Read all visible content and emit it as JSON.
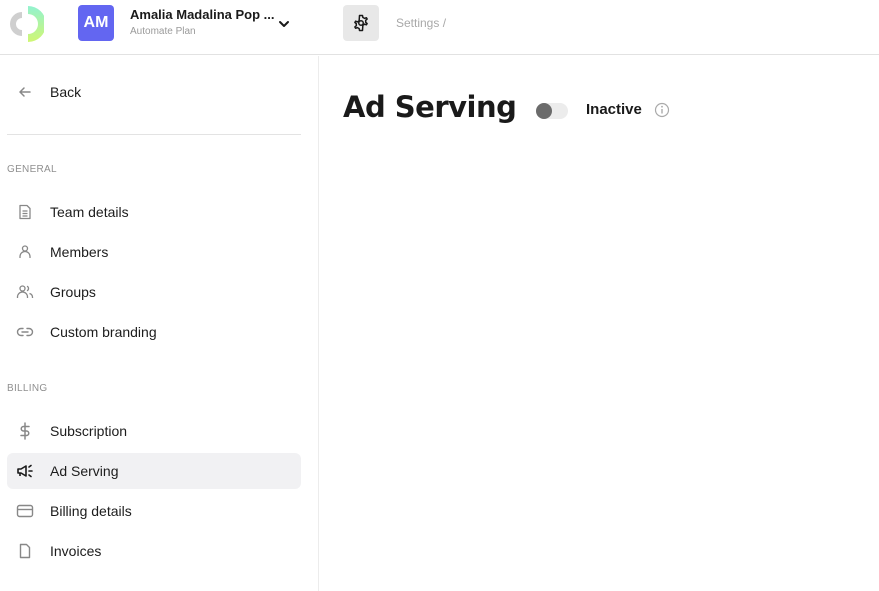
{
  "header": {
    "avatar_initials": "AM",
    "team_name": "Amalia Madalina Pop ...",
    "plan": "Automate Plan",
    "breadcrumb": "Settings /"
  },
  "sidebar": {
    "back_label": "Back",
    "sections": [
      {
        "title": "GENERAL",
        "items": [
          {
            "label": "Team details",
            "icon": "document-icon"
          },
          {
            "label": "Members",
            "icon": "user-icon"
          },
          {
            "label": "Groups",
            "icon": "users-icon"
          },
          {
            "label": "Custom branding",
            "icon": "link-icon"
          }
        ]
      },
      {
        "title": "BILLING",
        "items": [
          {
            "label": "Subscription",
            "icon": "dollar-icon"
          },
          {
            "label": "Ad Serving",
            "icon": "megaphone-icon",
            "active": true
          },
          {
            "label": "Billing details",
            "icon": "credit-card-icon"
          },
          {
            "label": "Invoices",
            "icon": "file-icon"
          }
        ]
      }
    ]
  },
  "main": {
    "title": "Ad Serving",
    "toggle_on": false,
    "status": "Inactive"
  },
  "colors": {
    "avatar_bg": "#6366f1",
    "active_item_bg": "#f1f1f3",
    "toggle_knob": "#6b6b6b"
  }
}
